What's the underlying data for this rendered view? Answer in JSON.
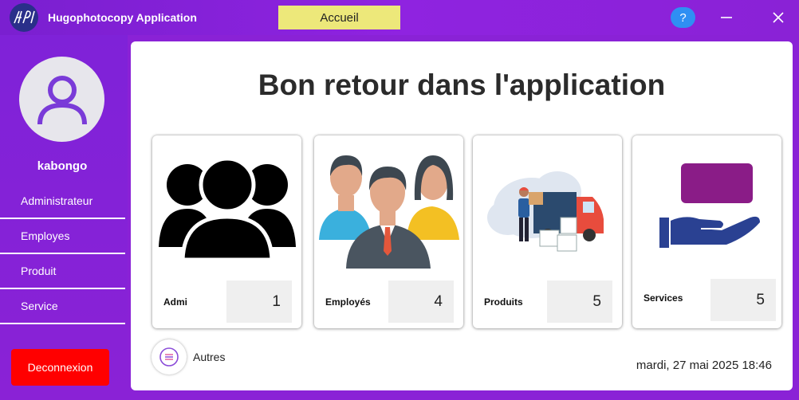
{
  "titlebar": {
    "app_title": "Hugophotocopy Application",
    "home_label": "Accueil",
    "help_label": "?",
    "minimize_symbol": "—",
    "close_symbol": "✕"
  },
  "sidebar": {
    "username": "kabongo",
    "items": [
      {
        "label": "Administrateur"
      },
      {
        "label": "Employes"
      },
      {
        "label": "Produit"
      },
      {
        "label": "Service"
      }
    ],
    "logout_label": "Deconnexion"
  },
  "main": {
    "welcome": "Bon retour dans l'application",
    "cards": [
      {
        "label": "Admi",
        "count": "1",
        "icon": "users-silhouette-icon"
      },
      {
        "label": "Employés",
        "count": "4",
        "icon": "employees-group-icon"
      },
      {
        "label": "Produits",
        "count": "5",
        "icon": "delivery-truck-icon"
      },
      {
        "label": "Services",
        "count": "5",
        "icon": "hand-service-icon"
      }
    ],
    "autres_label": "Autres",
    "datetime": "mardi, 27 mai 2025 18:46"
  },
  "colors": {
    "sidebar": "#8a22d6",
    "home_button": "#ede87a",
    "help_button": "#2f8ff3",
    "logout": "#ff0000"
  }
}
